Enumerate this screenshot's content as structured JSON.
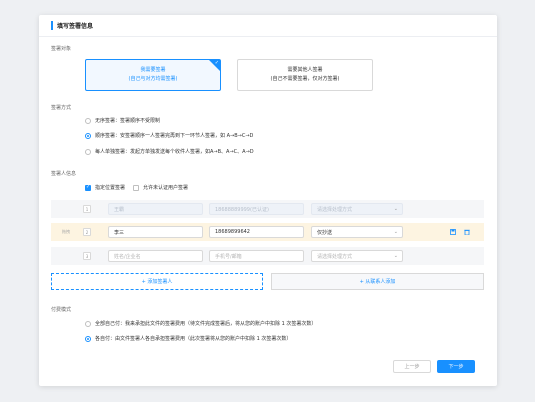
{
  "page_title": "填写签署信息",
  "sections": {
    "target": "签署对象",
    "method": "签署方式",
    "signer_info": "签署人信息",
    "payment": "付费模式"
  },
  "target_options": [
    {
      "title": "我需要签署",
      "sub": "(自己与对方均需签署)"
    },
    {
      "title": "需要其他人签署",
      "sub": "(自己不需要签署，仅对方签署)"
    }
  ],
  "methods": [
    "无序签署：签署顺序不受限制",
    "顺序签署：安签署顺序一人签署完再到下一环节人签署，如 A→B→C→D",
    "每人单独签署：发起方单独发送每个收件人签署，如A→B、A→C、A→D"
  ],
  "checks": {
    "specify_position": "指定位置签署",
    "allow_unregistered": "允许未认证用户签署"
  },
  "rows": [
    {
      "num": "1",
      "name": "王霸",
      "phone": "18688889999(已认证)",
      "method": "请选择处理方式"
    },
    {
      "num": "2",
      "name": "李三",
      "phone": "18689899642",
      "method": "仅抄送"
    },
    {
      "num": "3",
      "name": "",
      "phone": "",
      "method": ""
    }
  ],
  "placeholders": {
    "name": "姓名/企业名",
    "phone": "手机号/邮箱",
    "method": "请选择处理方式"
  },
  "drag_label": "拖拽",
  "add_signer": "+ 添加签署人",
  "add_from_contacts": "+ 从联系人添加",
  "payment_options": [
    "全部自己付：我来承担此文件的签署费用（待文件完成签署后，将从您的账户中扣除 1 次签署次数）",
    "各自付：由文件签署人各自承担签署费用（此次签署将从您的账户中扣除 1 次签署次数）"
  ],
  "buttons": {
    "prev": "上一步",
    "next": "下一步"
  },
  "colors": {
    "accent": "#1890ff",
    "highlight_row": "#fdf4e1"
  }
}
